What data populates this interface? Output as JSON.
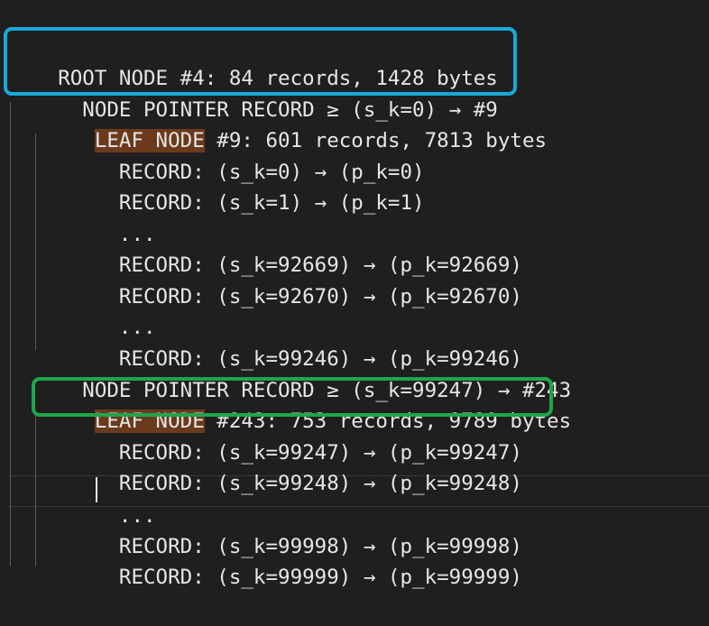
{
  "colors": {
    "background": "#1f1f1f",
    "text": "#e6e6e6",
    "leaf_highlight": "#6b3a1c",
    "box_root": "#1ba8d8",
    "box_leaf": "#1fa64a"
  },
  "lines": [
    {
      "prefix": "",
      "text": "ROOT NODE #4: 84 records, 1428 bytes"
    },
    {
      "prefix": "",
      "text": "  NODE POINTER RECORD ≥ (s_k=0) → #9"
    },
    {
      "prefix": "   ",
      "highlight": "LEAF NODE",
      "text": " #9: 601 records, 7813 bytes"
    },
    {
      "prefix": "",
      "text": "     RECORD: (s_k=0) → (p_k=0)"
    },
    {
      "prefix": "",
      "text": "     RECORD: (s_k=1) → (p_k=1)"
    },
    {
      "prefix": "",
      "text": "     ..."
    },
    {
      "prefix": "",
      "text": "     RECORD: (s_k=92669) → (p_k=92669)"
    },
    {
      "prefix": "",
      "text": "     RECORD: (s_k=92670) → (p_k=92670)"
    },
    {
      "prefix": "",
      "text": "     ..."
    },
    {
      "prefix": "",
      "text": "     RECORD: (s_k=99246) → (p_k=99246)"
    },
    {
      "prefix": "",
      "text": "  NODE POINTER RECORD ≥ (s_k=99247) → #243"
    },
    {
      "prefix": "   ",
      "highlight": "LEAF NODE",
      "text": " #243: 753 records, 9789 bytes"
    },
    {
      "prefix": "",
      "text": "     RECORD: (s_k=99247) → (p_k=99247)"
    },
    {
      "prefix": "",
      "text": "     RECORD: (s_k=99248) → (p_k=99248)"
    },
    {
      "prefix": "",
      "text": "     ..."
    },
    {
      "prefix": "",
      "text": "     RECORD: (s_k=99998) → (p_k=99998)"
    },
    {
      "prefix": "",
      "text": "     RECORD: (s_k=99999) → (p_k=99999)"
    }
  ]
}
